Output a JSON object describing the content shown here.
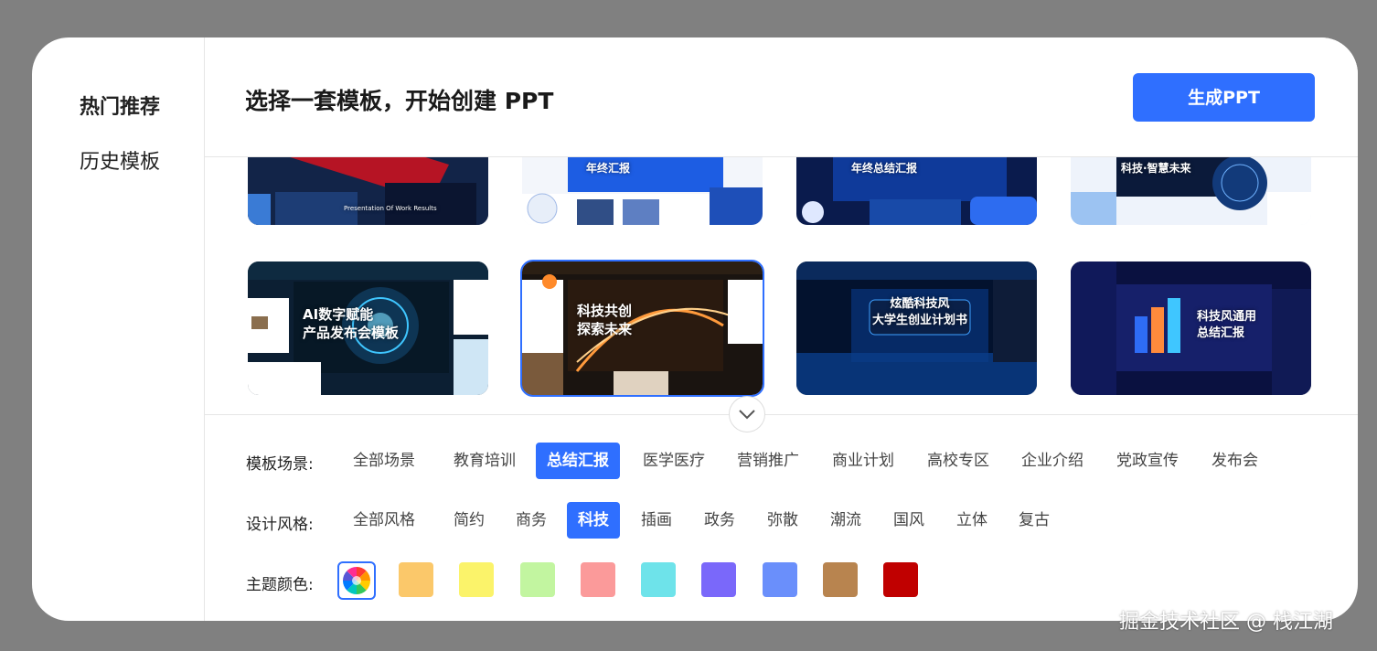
{
  "sidebar": {
    "items": [
      {
        "label": "热门推荐",
        "active": true
      },
      {
        "label": "历史模板",
        "active": false
      }
    ]
  },
  "header": {
    "title": "选择一套模板，开始创建 PPT",
    "generate_label": "生成PPT"
  },
  "templates": {
    "row1": [
      {
        "text": "Presentation Of Work Results",
        "theme": "red-dark"
      },
      {
        "text": "年终汇报",
        "theme": "blue-white"
      },
      {
        "text": "年终总结汇报",
        "theme": "blue-dark"
      },
      {
        "text": "科技·智慧未来",
        "theme": "tech-light"
      }
    ],
    "row2": [
      {
        "title": "AI数字赋能\n产品发布会模板",
        "theme": "cyan-dark",
        "selected": false
      },
      {
        "title": "科技共创\n探索未来",
        "theme": "orange-dark",
        "selected": true
      },
      {
        "title": "炫酷科技风\n大学生创业计划书",
        "theme": "blue-glow",
        "selected": false
      },
      {
        "title": "科技风通用\n总结汇报",
        "theme": "purple-dark",
        "selected": false
      }
    ]
  },
  "filters": {
    "scene": {
      "label": "模板场景:",
      "options": [
        "全部场景",
        "教育培训",
        "总结汇报",
        "医学医疗",
        "营销推广",
        "商业计划",
        "高校专区",
        "企业介绍",
        "党政宣传",
        "发布会"
      ],
      "selected": "总结汇报"
    },
    "style": {
      "label": "设计风格:",
      "options": [
        "全部风格",
        "简约",
        "商务",
        "科技",
        "插画",
        "政务",
        "弥散",
        "潮流",
        "国风",
        "立体",
        "复古"
      ],
      "selected": "科技"
    },
    "color": {
      "label": "主题颜色:",
      "swatches": [
        "#fbc86a",
        "#fbf36a",
        "#c2f5a0",
        "#fb9a9a",
        "#6ee3ea",
        "#7a68fa",
        "#6a8ffb",
        "#b8844f",
        "#c00000"
      ]
    }
  },
  "watermark": "掘金技术社区 @ 栈江湖"
}
